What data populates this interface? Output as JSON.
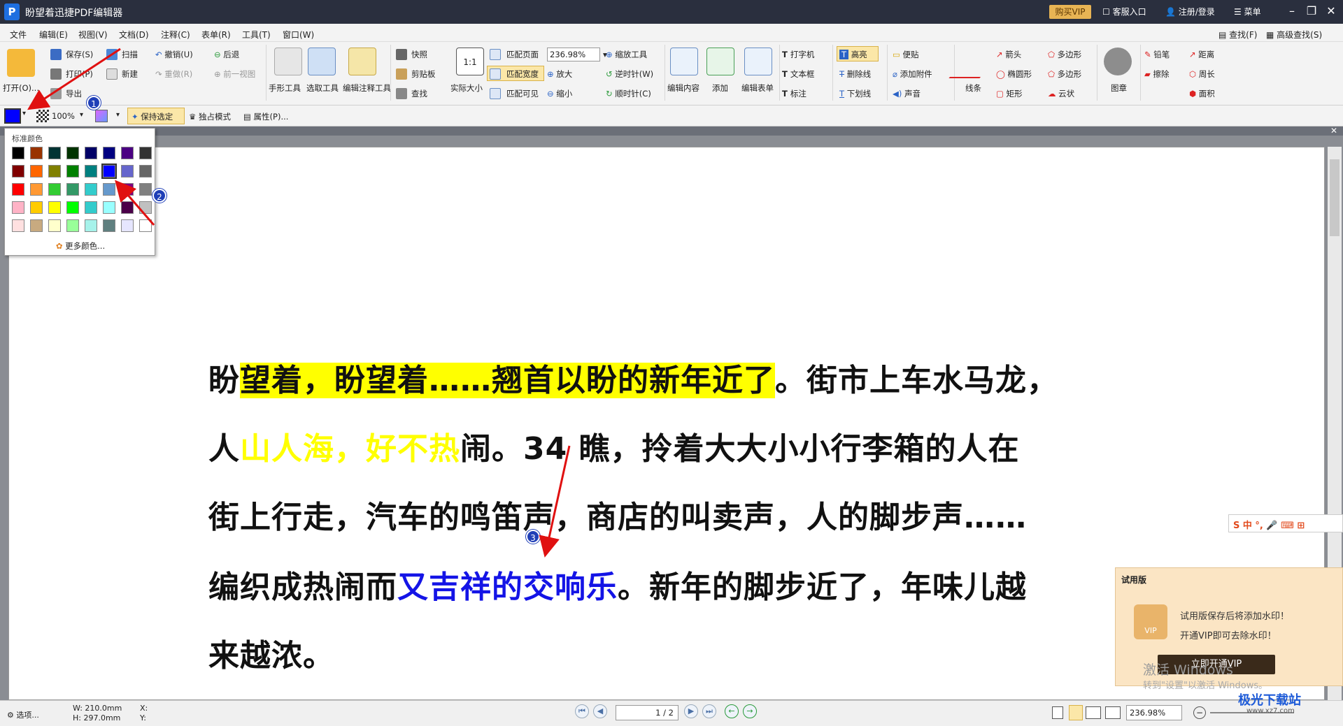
{
  "app": {
    "logo": "P",
    "title": "盼望着迅捷PDF编辑器"
  },
  "titlebar": {
    "vip": "购买VIP",
    "service": "客服入口",
    "login": "注册/登录",
    "menu": "菜单"
  },
  "menubar": [
    "文件",
    "编辑(E)",
    "视图(V)",
    "文档(D)",
    "注释(C)",
    "表单(R)",
    "工具(T)",
    "窗口(W)"
  ],
  "search": {
    "find": "查找(F)",
    "advanced": "高级查找(S)"
  },
  "ribbon": {
    "open": "打开(O)...",
    "save": "保存(S)",
    "print": "打印(P)",
    "export": "导出",
    "scan": "扫描",
    "new": "新建",
    "undo": "撤销(U)",
    "redo": "重做(R)",
    "back": "后退",
    "prev_view": "前一视图",
    "hand": "手形工具",
    "select": "选取工具",
    "edit_annot": "编辑注释工具",
    "snapshot": "快照",
    "clipboard": "剪贴板",
    "find": "查找",
    "actual": "实际大小",
    "fit_page": "匹配页面",
    "fit_width": "匹配宽度",
    "fit_visible": "匹配可见",
    "zoom_value": "236.98%",
    "zoom_in": "放大",
    "zoom_out": "缩小",
    "zoom_tool": "缩放工具",
    "rotate_ccw": "逆时针(W)",
    "rotate_cw": "顺时针(C)",
    "edit_content": "编辑内容",
    "add": "添加",
    "edit_form": "编辑表单",
    "typewriter": "打字机",
    "textbox": "文本框",
    "callout": "标注",
    "highlight": "高亮",
    "strikeout": "删除线",
    "underline": "下划线",
    "note": "便贴",
    "attach": "添加附件",
    "sound": "声音",
    "line": "线条",
    "arrow": "箭头",
    "ellipse": "椭圆形",
    "rect": "矩形",
    "polygon": "多边形",
    "polyline": "多边形",
    "cloud": "云状",
    "stamp": "图章",
    "pencil": "铅笔",
    "eraser": "擦除",
    "distance": "距离",
    "perimeter": "周长",
    "area": "面积"
  },
  "props": {
    "opacity": "100%",
    "keep": "保持选定",
    "exclusive": "独占模式",
    "properties": "属性(P)..."
  },
  "palette": {
    "title": "标准颜色",
    "more": "更多颜色...",
    "rows": [
      [
        "#000000",
        "#993300",
        "#003333",
        "#003300",
        "#000066",
        "#000080",
        "#4b0082",
        "#333333"
      ],
      [
        "#800000",
        "#ff6600",
        "#808000",
        "#008000",
        "#008080",
        "#0000ff",
        "#6666cc",
        "#666666"
      ],
      [
        "#ff0000",
        "#ff9933",
        "#33cc33",
        "#339966",
        "#33cccc",
        "#6699cc",
        "#800080",
        "#808080"
      ],
      [
        "#ffb3c6",
        "#ffcc00",
        "#ffff00",
        "#00ff00",
        "#33cccc",
        "#99ffff",
        "#4b0049",
        "#c0c0c0"
      ],
      [
        "#ffe0e0",
        "#c8aa80",
        "#ffffcc",
        "#99ff99",
        "#a6f2ea",
        "#5f7f7f",
        "#e6e6ff",
        "#ffffff"
      ]
    ]
  },
  "steps": [
    "1",
    "2",
    "3"
  ],
  "document": {
    "l1_plain": "盼",
    "l1_hl": "望着，盼望着……翘首以盼的新年近了",
    "l1_rest": "。街市上车水马龙，",
    "l2_a": "人",
    "l2_yel": "山人海，好不热",
    "l2_b": "闹。34 瞧，拎着大大小小行李箱的人在",
    "l3": "街上行走，汽车的鸣笛声，商店的叫卖声，人的脚步声……",
    "l4_a": "编织成热闹而",
    "l4_blue": "又吉祥的交响乐",
    "l4_b": "。新年的脚步近了，年味儿越",
    "l5": "来越浓。"
  },
  "trial": {
    "title": "试用版",
    "l1": "试用版保存后将添加水印！",
    "l2": "开通VIP即可去除水印！",
    "btn": "立即开通VIP",
    "badge": "VIP"
  },
  "watermark": {
    "l1": "激活 Windows",
    "l2": "转到\"设置\"以激活 Windows。"
  },
  "ime": {
    "label": "S 中 °, 🎤 ⌨ ⊞"
  },
  "status": {
    "options": "选项...",
    "w": "W: 210.0mm",
    "h": "H: 297.0mm",
    "x": "X:",
    "y": "Y:",
    "page": "1 / 2",
    "zoom": "236.98%"
  },
  "site": {
    "name": "极光下载站",
    "url": "www.xz7.com"
  },
  "colors": {
    "accent": "#1414e6",
    "highlight": "#ffff00",
    "vip": "#e8b454"
  }
}
